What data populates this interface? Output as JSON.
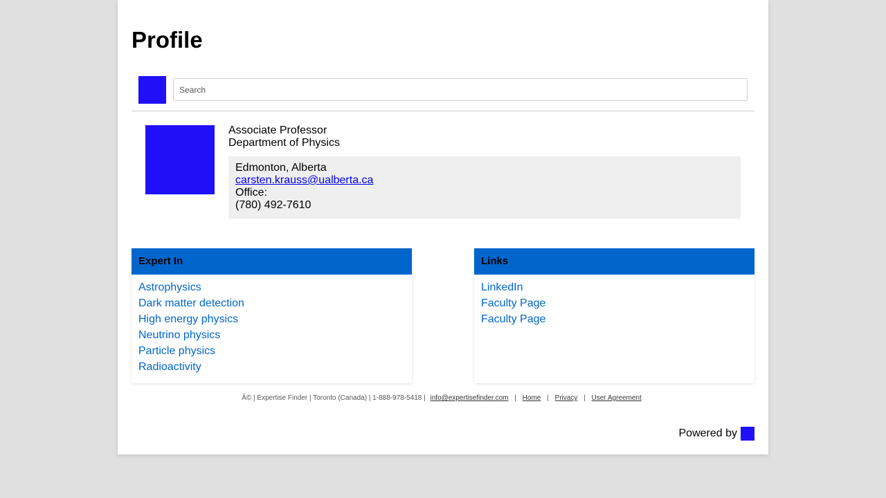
{
  "page": {
    "title": "Profile"
  },
  "search": {
    "placeholder": "Search",
    "value": ""
  },
  "profile": {
    "position": "Associate Professor",
    "department": "Department of Physics",
    "location": "Edmonton, Alberta",
    "email": "carsten.krauss@ualberta.ca",
    "office_label": "Office:",
    "phone": "(780) 492-7610"
  },
  "expert_in": {
    "header": "Expert In",
    "items": [
      "Astrophysics",
      "Dark matter detection",
      "High energy physics",
      "Neutrino physics",
      "Particle physics",
      "Radioactivity"
    ]
  },
  "links": {
    "header": "Links",
    "items": [
      "LinkedIn",
      "Faculty Page",
      "Faculty Page"
    ]
  },
  "footer": {
    "text": "Â© | Expertise Finder | Toronto (Canada) | 1-888-978-5418 |",
    "email": "info@expertisefinder.com",
    "sep": "|",
    "home": "Home",
    "privacy": "Privacy",
    "agreement": "User Agreement"
  },
  "powered_by": {
    "label": "Powered by"
  },
  "colors": {
    "accent": "#0066cc",
    "logo": "#2010f8",
    "background": "#e0e0e0"
  }
}
